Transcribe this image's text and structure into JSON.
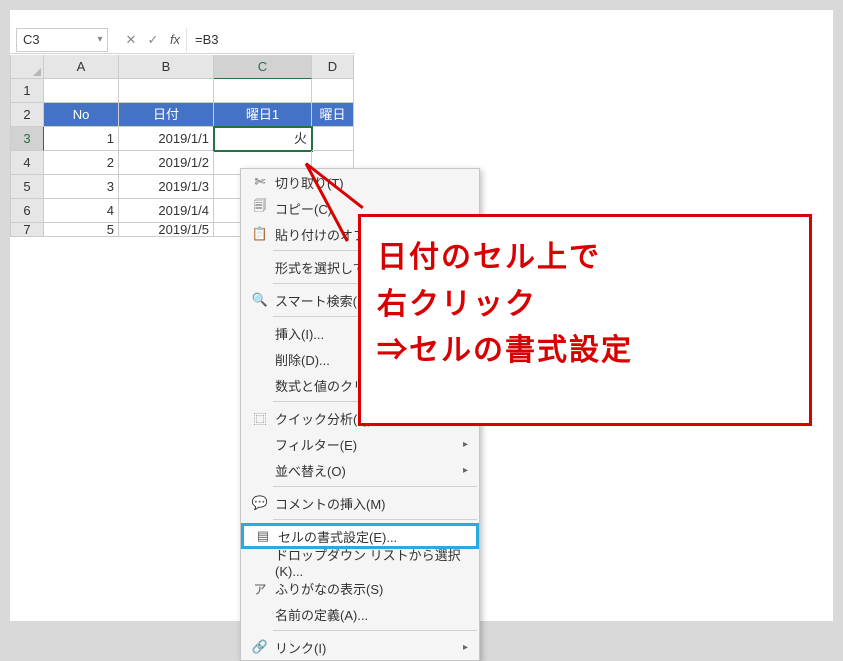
{
  "namebox": {
    "ref": "C3",
    "formula": "=B3"
  },
  "columns": [
    {
      "id": "A",
      "label": "A",
      "w": 75
    },
    {
      "id": "B",
      "label": "B",
      "w": 95
    },
    {
      "id": "C",
      "label": "C",
      "w": 98,
      "selected": true
    },
    {
      "id": "D",
      "label": "D",
      "w": 42
    }
  ],
  "header_row": {
    "A": "No",
    "B": "日付",
    "C": "曜日1",
    "D": "曜日"
  },
  "rows": [
    {
      "n": 1,
      "A": "",
      "B": "",
      "C": "",
      "D": ""
    },
    {
      "n": 2,
      "header": true
    },
    {
      "n": 3,
      "A": "1",
      "B": "2019/1/1",
      "C": "火",
      "D": "",
      "selected": true
    },
    {
      "n": 4,
      "A": "2",
      "B": "2019/1/2",
      "C": "",
      "D": ""
    },
    {
      "n": 5,
      "A": "3",
      "B": "2019/1/3",
      "C": "",
      "D": ""
    },
    {
      "n": 6,
      "A": "4",
      "B": "2019/1/4",
      "C": "",
      "D": ""
    },
    {
      "n": 7,
      "A": "5",
      "B": "2019/1/5",
      "C": "",
      "D": "",
      "half": true
    }
  ],
  "context_menu": [
    {
      "icon": "cut-icon",
      "glyph": "✄",
      "label": "切り取り(T)"
    },
    {
      "icon": "copy-icon",
      "glyph": "🗐",
      "label": "コピー(C)"
    },
    {
      "icon": "paste-options-icon",
      "glyph": "📋",
      "label": "貼り付けのオプ",
      "arrow": false,
      "truncated": true
    },
    {
      "sep": true,
      "under_paste": true
    },
    {
      "label": "形式を選択して",
      "truncated": true
    },
    {
      "sep": true
    },
    {
      "icon": "smart-lookup-icon",
      "glyph": "🔍",
      "label": "スマート検索(L"
    },
    {
      "sep": true
    },
    {
      "label": "挿入(I)..."
    },
    {
      "label": "削除(D)..."
    },
    {
      "label": "数式と値のクリ",
      "truncated": true
    },
    {
      "sep": true
    },
    {
      "icon": "quick-analysis-icon",
      "glyph": "⿴",
      "label": "クイック分析(Q)"
    },
    {
      "label": "フィルター(E)",
      "arrow": true
    },
    {
      "label": "並べ替え(O)",
      "arrow": true
    },
    {
      "sep": true
    },
    {
      "icon": "comment-icon",
      "glyph": "💬",
      "label": "コメントの挿入(M)"
    },
    {
      "sep": true
    },
    {
      "icon": "format-cells-icon",
      "glyph": "▤",
      "label": "セルの書式設定(E)...",
      "highlight": true
    },
    {
      "label": "ドロップダウン リストから選択(K)..."
    },
    {
      "icon": "phonetic-icon",
      "glyph": "ア",
      "label": "ふりがなの表示(S)"
    },
    {
      "label": "名前の定義(A)..."
    },
    {
      "sep": true
    },
    {
      "icon": "link-icon",
      "glyph": "🔗",
      "label": "リンク(I)",
      "arrow": true
    }
  ],
  "callout": {
    "line1": "日付のセル上で",
    "line2": "右クリック",
    "line3": "⇒セルの書式設定"
  },
  "icons": {
    "chevron_down": "▾",
    "cancel": "✕",
    "check": "✓",
    "fx": "fx",
    "arrow_right": "▸"
  }
}
